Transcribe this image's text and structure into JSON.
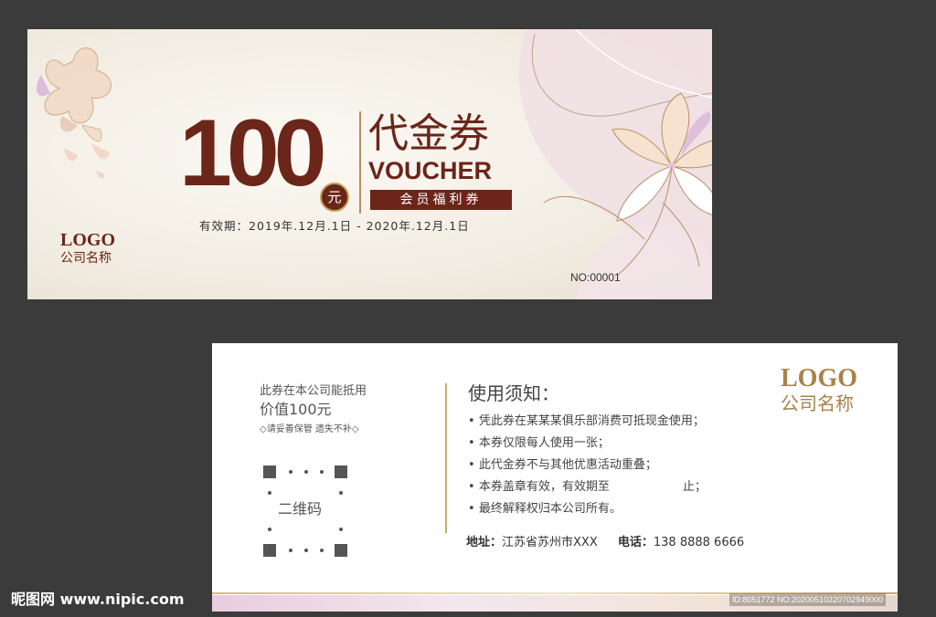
{
  "front": {
    "amount": "100",
    "yuan": "元",
    "title_cn": "代金券",
    "title_en": "VOUCHER",
    "member_label": "会员福利券",
    "validity": "有效期：2019年.12月.1日 - 2020年.12月.1日",
    "logo": "LOGO",
    "company": "公司名称",
    "serial": "NO:00001"
  },
  "back": {
    "line1": "此券在本公司能抵用",
    "line2": "价值100元",
    "line3": "◇请妥善保管 遗失不补◇",
    "qr_label": "二维码",
    "notice_title": "使用须知：",
    "notice": [
      "凭此券在某某某俱乐部消费可抵现金使用；",
      "本券仅限每人使用一张；",
      "此代金券不与其他优惠活动重叠；",
      "本券盖章有效，有效期至",
      "最终解释权归本公司所有。"
    ],
    "notice_tail": "止；",
    "address_label": "地址：",
    "address": "江苏省苏州市XXX",
    "phone_label": "电话：",
    "phone": "138 8888 6666",
    "logo": "LOGO",
    "company": "公司名称"
  },
  "watermark": {
    "site": "昵图网 www.nipic.com",
    "id": "ID:8051772 NO:20200510220702949000"
  },
  "colors": {
    "brand_brown": "#6b2519",
    "gold": "#a8824a",
    "background": "#3b3b3b"
  }
}
